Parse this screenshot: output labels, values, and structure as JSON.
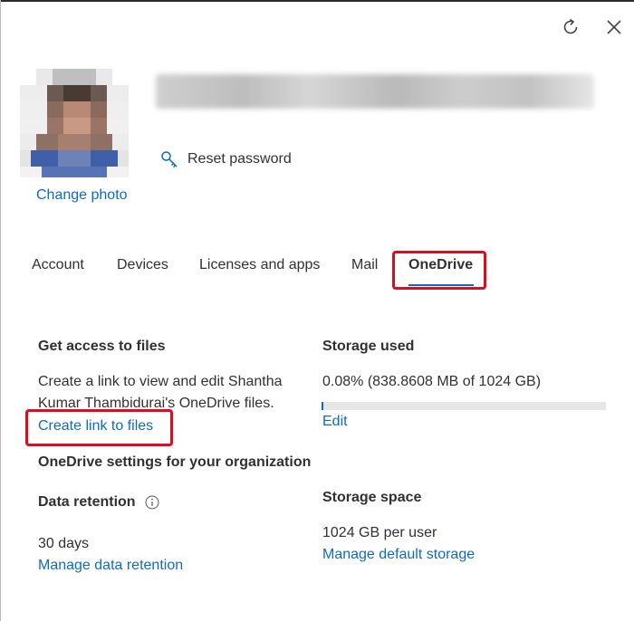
{
  "header": {
    "refresh_icon": "refresh-icon",
    "close_icon": "close-icon"
  },
  "profile": {
    "change_photo": "Change photo",
    "reset_password": "Reset password"
  },
  "tabs": [
    {
      "label": "Account"
    },
    {
      "label": "Devices"
    },
    {
      "label": "Licenses and apps"
    },
    {
      "label": "Mail"
    },
    {
      "label": "OneDrive",
      "active": true
    }
  ],
  "access": {
    "heading": "Get access to files",
    "description": "Create a link to view and edit Shantha Kumar Thambidurai's OneDrive files.",
    "link": "Create link to files"
  },
  "storage": {
    "heading": "Storage used",
    "usage": "0.08% (838.8608 MB of 1024 GB)",
    "used_fraction": 0.0008,
    "edit": "Edit"
  },
  "org_settings": {
    "heading": "OneDrive settings for your organization"
  },
  "retention": {
    "heading": "Data retention",
    "value": "30 days",
    "link": "Manage data retention"
  },
  "space": {
    "heading": "Storage space",
    "value": "1024 GB per user",
    "link": "Manage default storage"
  },
  "colors": {
    "accent": "#0f6cbd",
    "highlight": "#d90f1f"
  }
}
